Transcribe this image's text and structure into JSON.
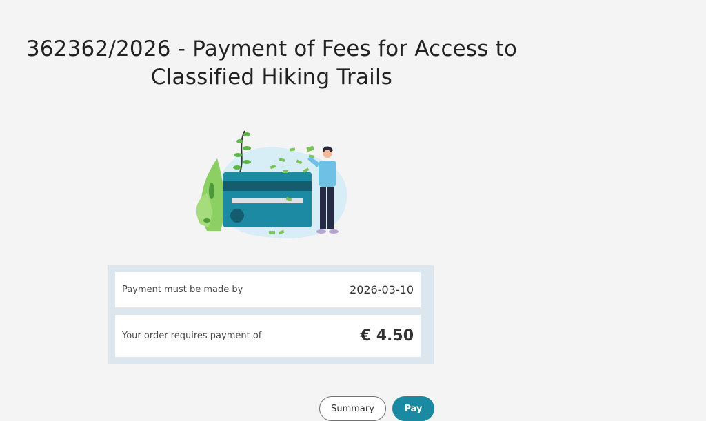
{
  "page": {
    "title_line1": "362362/2026 - Payment of Fees for Access to",
    "title_line2": "Classified Hiking Trails"
  },
  "payment": {
    "deadline_label": "Payment must be made by",
    "deadline_value": "2026-03-10",
    "amount_label": "Your order requires payment of",
    "amount_value": "€ 4.50"
  },
  "actions": {
    "summary_label": "Summary",
    "pay_label": "Pay"
  },
  "colors": {
    "accent": "#1a8aa3",
    "panel_bg": "#dce6ef",
    "page_bg": "#f4f4f4",
    "card": "#1d7f98",
    "leaf": "#7cc45a"
  },
  "illustration": {
    "icon": "payment-card-illustration"
  }
}
